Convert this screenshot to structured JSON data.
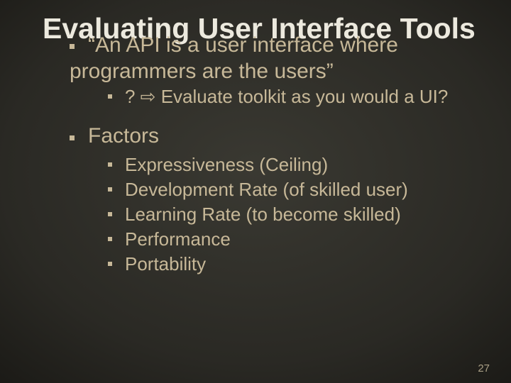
{
  "title": "Evaluating User Interface Tools",
  "bullets": {
    "b1_line1": "“An API is a user interface where",
    "b1_line2": "programmers are the users”",
    "b1_sub": "? ⇨ Evaluate toolkit as you would a UI?",
    "b2": "Factors",
    "factors": {
      "f1": "Expressiveness (Ceiling)",
      "f2": "Development Rate (of skilled user)",
      "f3": "Learning Rate (to become skilled)",
      "f4": "Performance",
      "f5": "Portability"
    }
  },
  "page": "27"
}
